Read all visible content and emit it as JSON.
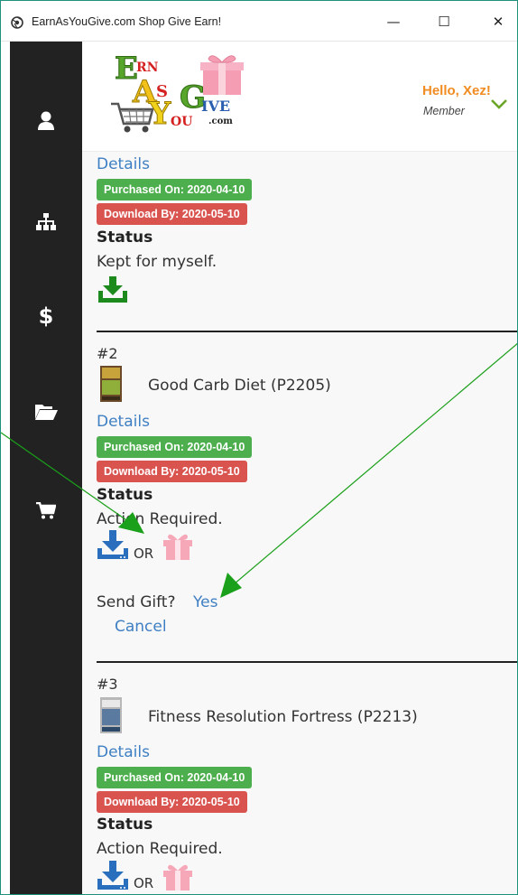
{
  "window": {
    "title": "EarnAsYouGive.com Shop Give Earn!",
    "minimize_glyph": "—",
    "maximize_glyph": "☐",
    "close_glyph": "✕"
  },
  "sidebar": {
    "items": [
      {
        "icon": "user-icon"
      },
      {
        "icon": "sitemap-icon"
      },
      {
        "icon": "dollar-icon"
      },
      {
        "icon": "folder-open-icon"
      },
      {
        "icon": "shopping-cart-icon"
      }
    ]
  },
  "header": {
    "logo_letters": {
      "e": "E",
      "a": "A",
      "rn": "RN",
      "s": "S",
      "y": "Y",
      "g": "G",
      "ou": "OU",
      "ive": "IVE",
      "com": ".com"
    },
    "greeting": "Hello, Xez!",
    "role": "Member"
  },
  "orders": [
    {
      "number": "",
      "product": "",
      "details_label": "Details",
      "purchased": "Purchased On: 2020-04-10",
      "download_by": "Download By: 2020-05-10",
      "status_label": "Status",
      "status": "Kept for myself."
    },
    {
      "number": "#2",
      "product": "Good Carb Diet (P2205)",
      "details_label": "Details",
      "purchased": "Purchased On: 2020-04-10",
      "download_by": "Download By: 2020-05-10",
      "status_label": "Status",
      "status": "Action Required.",
      "or_text": "OR",
      "send_gift_label": "Send Gift?",
      "yes_label": "Yes",
      "cancel_label": "Cancel"
    },
    {
      "number": "#3",
      "product": "Fitness Resolution Fortress (P2213)",
      "details_label": "Details",
      "purchased": "Purchased On: 2020-04-10",
      "download_by": "Download By: 2020-05-10",
      "status_label": "Status",
      "status": "Action Required.",
      "or_text": "OR"
    }
  ],
  "colors": {
    "sidebar_bg": "#222222",
    "greeting": "#f08c21",
    "link": "#3f7fc3",
    "badge_green": "#4cae4c",
    "badge_red": "#d9534f",
    "download_green": "#1c8a1c",
    "download_blue": "#2a6fbd",
    "gift_pink": "#f7a8b8",
    "annotation_arrow": "#1aa01a"
  }
}
